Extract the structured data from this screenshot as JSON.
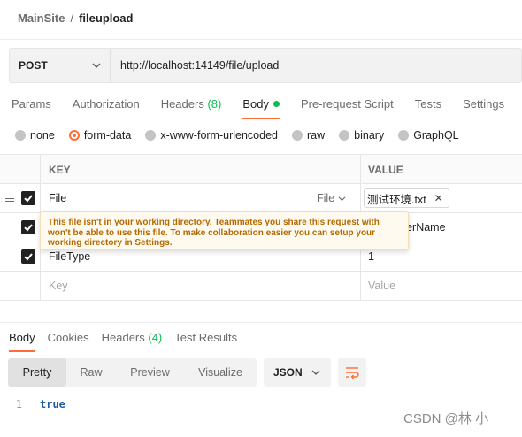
{
  "breadcrumb": {
    "parent": "MainSite",
    "separator": "/",
    "current": "fileupload"
  },
  "request": {
    "method": "POST",
    "url": "http://localhost:14149/file/upload"
  },
  "request_tabs": [
    {
      "label": "Params"
    },
    {
      "label": "Authorization"
    },
    {
      "label": "Headers",
      "count": "(8)"
    },
    {
      "label": "Body",
      "active": true
    },
    {
      "label": "Pre-request Script"
    },
    {
      "label": "Tests"
    },
    {
      "label": "Settings"
    }
  ],
  "body_types": [
    "none",
    "form-data",
    "x-www-form-urlencoded",
    "raw",
    "binary",
    "GraphQL"
  ],
  "body_type_selected": "form-data",
  "table": {
    "headers": {
      "key": "KEY",
      "value": "VALUE"
    },
    "rows": [
      {
        "key": "File",
        "type": "File",
        "value": "测试环境.txt",
        "checked": true
      },
      {
        "key": "",
        "value": "ContainerName",
        "checked": true
      },
      {
        "key": "FileType",
        "value": "1",
        "checked": true
      }
    ],
    "new_row": {
      "key_placeholder": "Key",
      "value_placeholder": "Value"
    }
  },
  "tooltip": {
    "text": "This file isn't in your working directory. Teammates you share this request with won't be able to use this file. To make collaboration easier you can setup your working directory in Settings."
  },
  "response_tabs": [
    {
      "label": "Body",
      "active": true
    },
    {
      "label": "Cookies"
    },
    {
      "label": "Headers",
      "count": "(4)"
    },
    {
      "label": "Test Results"
    }
  ],
  "view_modes": [
    "Pretty",
    "Raw",
    "Preview",
    "Visualize"
  ],
  "view_mode_selected": "Pretty",
  "format": "JSON",
  "response_body": {
    "line_number": "1",
    "content": "true"
  },
  "watermark": "CSDN @林 小",
  "colors": {
    "accent": "#ff6c37",
    "success": "#0cbb52",
    "warning_text": "#b46a00"
  }
}
